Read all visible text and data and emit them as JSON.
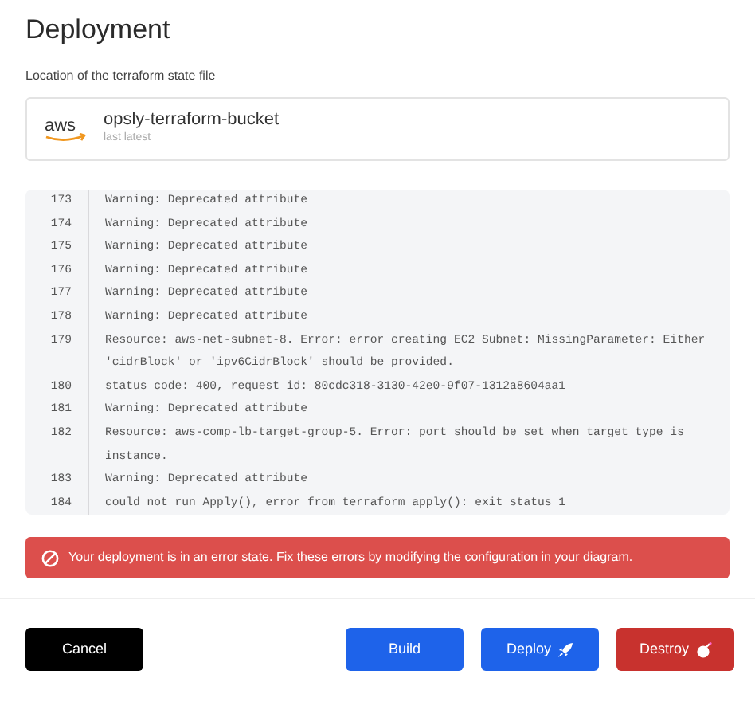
{
  "title": "Deployment",
  "state_file": {
    "label": "Location of the terraform state file",
    "logo_text": "aws",
    "bucket": "opsly-terraform-bucket",
    "version": "last latest"
  },
  "log": [
    {
      "number": "173",
      "text": "Warning: Deprecated attribute"
    },
    {
      "number": "174",
      "text": "Warning: Deprecated attribute"
    },
    {
      "number": "175",
      "text": "Warning: Deprecated attribute"
    },
    {
      "number": "176",
      "text": "Warning: Deprecated attribute"
    },
    {
      "number": "177",
      "text": "Warning: Deprecated attribute"
    },
    {
      "number": "178",
      "text": "Warning: Deprecated attribute"
    },
    {
      "number": "179",
      "text": "Resource: aws-net-subnet-8. Error: error creating EC2 Subnet: MissingParameter: Either 'cidrBlock' or 'ipv6CidrBlock' should be provided."
    },
    {
      "number": "180",
      "text": "status code: 400, request id: 80cdc318-3130-42e0-9f07-1312a8604aa1"
    },
    {
      "number": "181",
      "text": "Warning: Deprecated attribute"
    },
    {
      "number": "182",
      "text": "Resource: aws-comp-lb-target-group-5. Error: port should be set when target type is instance."
    },
    {
      "number": "183",
      "text": "Warning: Deprecated attribute"
    },
    {
      "number": "184",
      "text": "could not run Apply(), error from terraform apply(): exit status 1"
    }
  ],
  "alert": "Your deployment is in an error state. Fix these errors by modifying the configuration in your diagram.",
  "buttons": [
    {
      "label": "Cancel",
      "kind": "cancel"
    },
    {
      "label": "Build",
      "kind": "build"
    },
    {
      "label": "Deploy",
      "kind": "deploy"
    },
    {
      "label": "Destroy",
      "kind": "destroy"
    }
  ]
}
